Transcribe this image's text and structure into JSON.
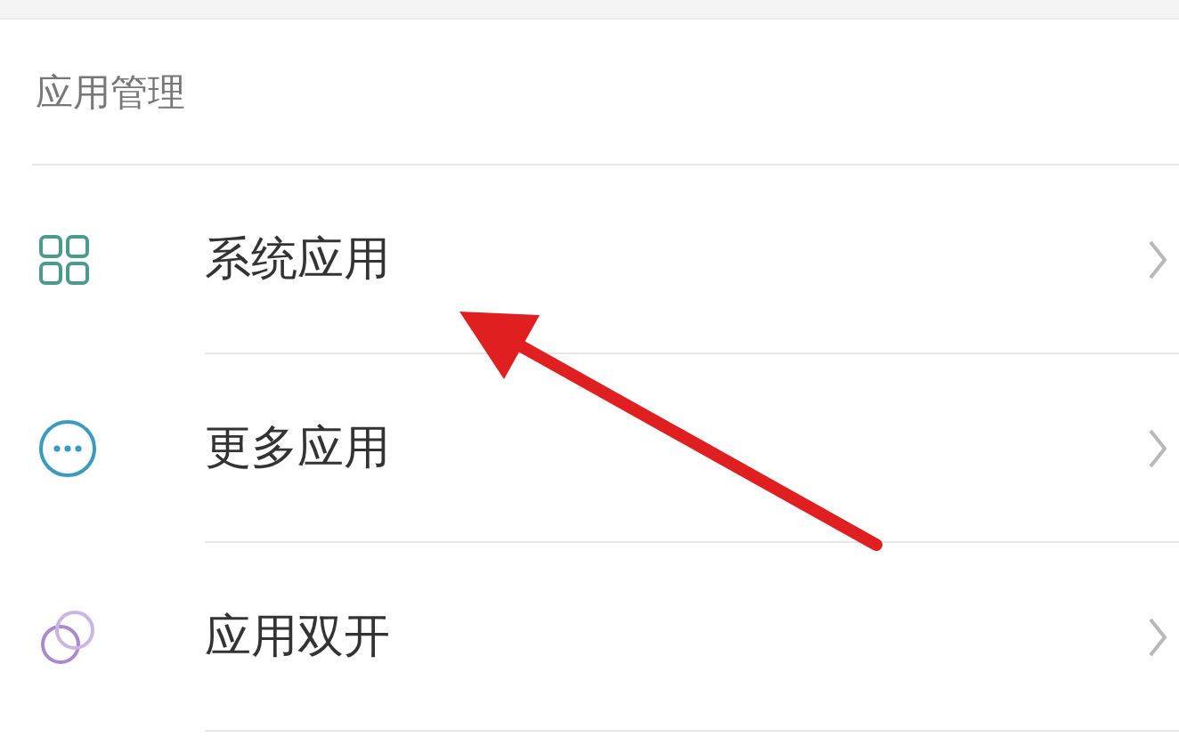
{
  "section": {
    "title": "应用管理"
  },
  "items": [
    {
      "label": "系统应用",
      "kind": "grid"
    },
    {
      "label": "更多应用",
      "kind": "dots"
    },
    {
      "label": "应用双开",
      "kind": "dual"
    }
  ]
}
